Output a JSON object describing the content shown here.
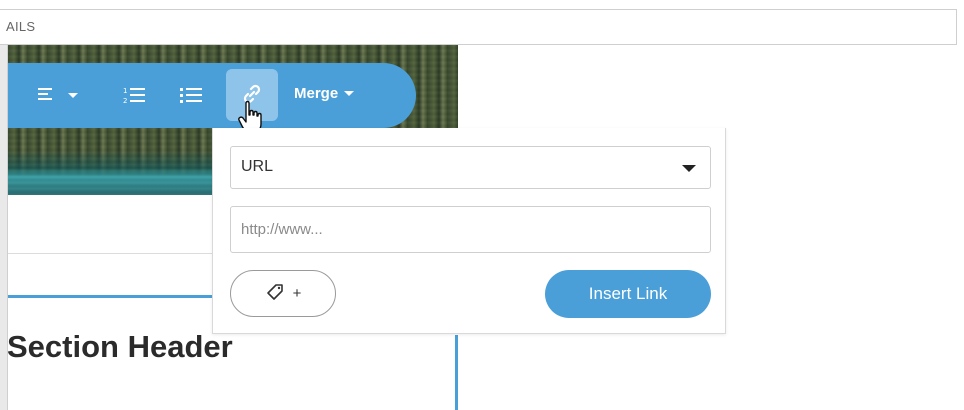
{
  "topbar": {
    "label": "AILS"
  },
  "toolbar": {
    "merge_label": "Merge"
  },
  "link_popup": {
    "link_type_selected": "URL",
    "url_placeholder": "http://www...",
    "tag_button_label": "+",
    "insert_button_label": "Insert Link"
  },
  "content": {
    "section_header": "Section Header"
  },
  "icons": {
    "align": "align-left-icon",
    "ordered_list": "ordered-list-icon",
    "bullet_list": "bullet-list-icon",
    "link": "link-icon",
    "tag": "tag-icon",
    "cursor": "hand-pointer-icon"
  },
  "colors": {
    "accent": "#4a9fd8",
    "link_button_active": "#8fc4ea"
  }
}
